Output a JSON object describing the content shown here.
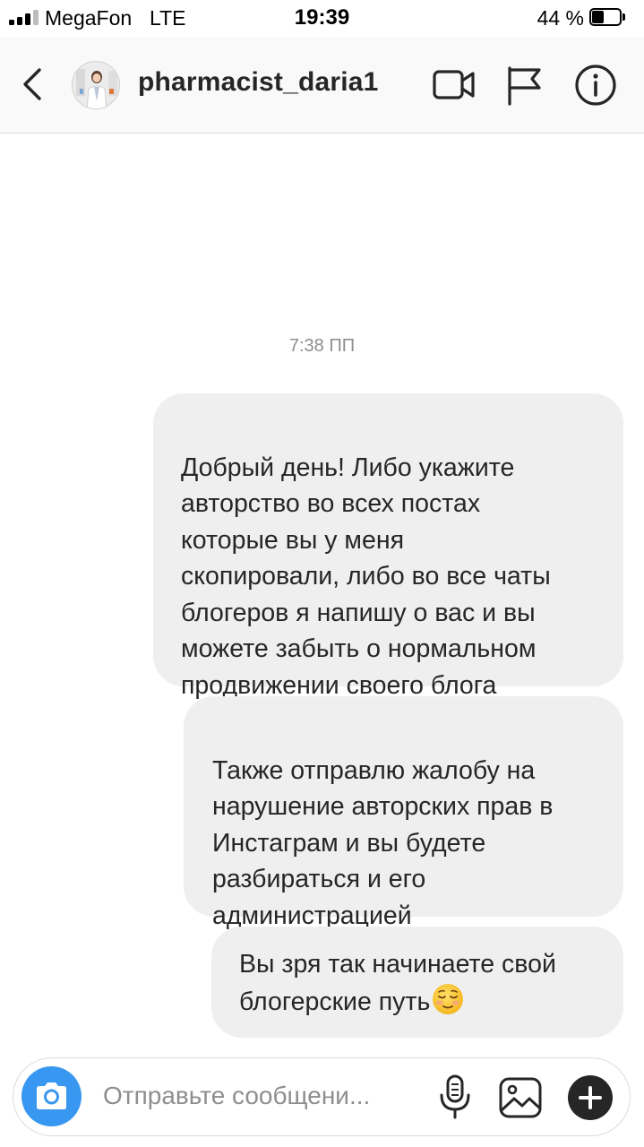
{
  "status_bar": {
    "carrier": "MegaFon",
    "network": "LTE",
    "time": "19:39",
    "battery_percent": "44 %",
    "battery_level": 0.44,
    "signal_bars": 3
  },
  "header": {
    "username": "pharmacist_daria1",
    "icons": [
      "chevron-left-icon",
      "video-camera-icon",
      "flag-icon",
      "info-icon"
    ]
  },
  "chat": {
    "timestamp": "7:38 ПП",
    "messages": [
      {
        "text": "Добрый день! Либо укажите\nавторство во всех постах\nкоторые вы у меня\nскопировали, либо во все чаты\nблогеров я напишу о вас и вы\nможете забыть о нормальном\nпродвижении своего блога"
      },
      {
        "text": "Также отправлю жалобу на\nнарушение авторских прав в\nИнстаграм и вы будете\nразбираться и его\nадминистрацией"
      },
      {
        "text": "Вы зря так начинаете свой\nблогерские путь",
        "emoji": "relieved-face"
      }
    ]
  },
  "composer": {
    "placeholder": "Отправьте сообщени...",
    "value": "",
    "icons": [
      "camera-icon",
      "microphone-icon",
      "gallery-icon",
      "plus-icon"
    ]
  },
  "colors": {
    "accent": "#3897f0",
    "bubble": "#efefef",
    "text": "#262626",
    "muted": "#8e8e8e",
    "header_bg": "#f9f9f9"
  }
}
